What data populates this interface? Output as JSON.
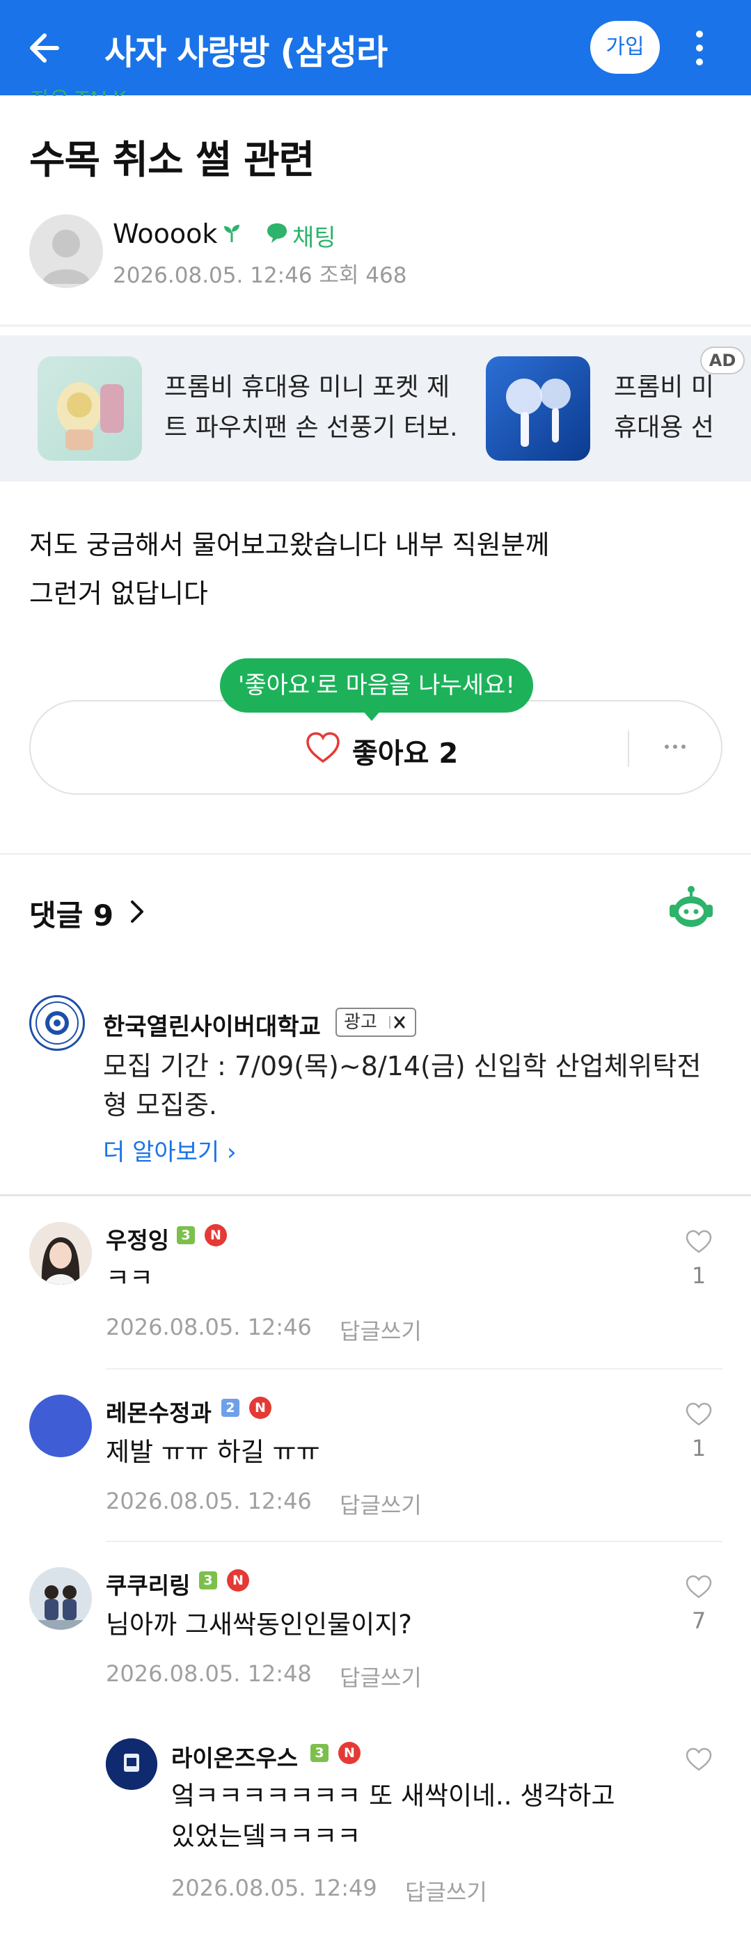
{
  "header": {
    "title": "사자 사랑방 (삼성라",
    "join_label": "가입",
    "bg_color": "#1a73e8",
    "icons": [
      "back-arrow-icon",
      "more-vertical-icon"
    ]
  },
  "post": {
    "category_cut": "자유 TALK",
    "title": "수목 취소 썰 관련",
    "author": "Wooook",
    "chat_label": "채팅",
    "meta": "2026.08.05. 12:46  조회 468",
    "body_lines": [
      "저도 궁금해서 물어보고왔습니다 내부 직원분께",
      "그런거 없답니다"
    ]
  },
  "ads": {
    "badge": "AD",
    "items": [
      {
        "line1": "프롬비 휴대용 미니 포켓 제",
        "line2": "트 파우치팬 손 선풍기 터보..."
      },
      {
        "line1": "프롬비 미",
        "line2": "휴대용 선"
      }
    ]
  },
  "like": {
    "bubble": "'좋아요'로 마음을 나누세요!",
    "label": "좋아요 2"
  },
  "comments_header": {
    "label": "댓글 9"
  },
  "sponsored": {
    "name": "한국열린사이버대학교",
    "tag": "광고",
    "desc": "모집 기간 : 7/09(목)~8/14(금) 신입학 산업체위탁전형 모집중.",
    "more": "더 알아보기 ›"
  },
  "comments": [
    {
      "name": "우정잉",
      "level": "3",
      "new": "N",
      "text": "ㅋㅋ",
      "time": "2026.08.05. 12:46",
      "reply": "답글쓰기",
      "likes": "1"
    },
    {
      "name": "레몬수정과",
      "level": "2",
      "new": "N",
      "text": "제발 ㅠㅠ 하길 ㅠㅠ",
      "time": "2026.08.05. 12:46",
      "reply": "답글쓰기",
      "likes": "1"
    },
    {
      "name": "쿠쿠리링",
      "level": "3",
      "new": "N",
      "text": "님아까 그새싹동인인물이지?",
      "time": "2026.08.05. 12:48",
      "reply": "답글쓰기",
      "likes": "7"
    },
    {
      "name": "라이온즈우스",
      "level": "3",
      "new": "N",
      "text_lines": [
        "엌ㅋㅋㅋㅋㅋㅋㅋ 또 새싹이네.. 생각하고",
        "있었는뎈ㅋㅋㅋㅋ"
      ],
      "time": "2026.08.05. 12:49",
      "reply": "답글쓰기"
    }
  ]
}
